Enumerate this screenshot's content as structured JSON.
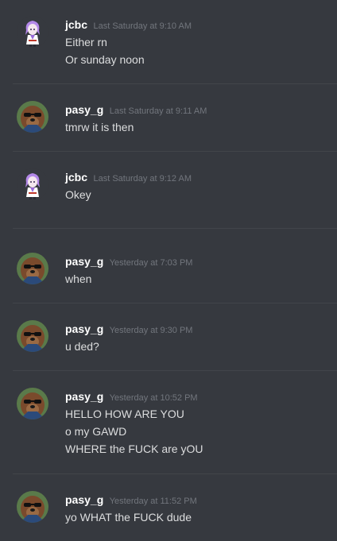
{
  "messages": [
    {
      "author": "jcbc",
      "timestamp": "Last Saturday at 9:10 AM",
      "avatar": "anime-avatar-icon",
      "lines": [
        "Either rn",
        "Or sunday noon"
      ]
    },
    {
      "author": "pasy_g",
      "timestamp": "Last Saturday at 9:11 AM",
      "avatar": "dog-sunglasses-avatar-icon",
      "lines": [
        "tmrw it is then"
      ]
    },
    {
      "author": "jcbc",
      "timestamp": "Last Saturday at 9:12 AM",
      "avatar": "anime-avatar-icon",
      "lines": [
        "Okey"
      ]
    },
    {
      "author": "pasy_g",
      "timestamp": "Yesterday at 7:03 PM",
      "avatar": "dog-sunglasses-avatar-icon",
      "lines": [
        "when"
      ]
    },
    {
      "author": "pasy_g",
      "timestamp": "Yesterday at 9:30 PM",
      "avatar": "dog-sunglasses-avatar-icon",
      "lines": [
        "u ded?"
      ]
    },
    {
      "author": "pasy_g",
      "timestamp": "Yesterday at 10:52 PM",
      "avatar": "dog-sunglasses-avatar-icon",
      "lines": [
        "HELLO HOW ARE YOU",
        "o my GAWD",
        "WHERE the FUCK are yOU"
      ]
    },
    {
      "author": "pasy_g",
      "timestamp": "Yesterday at 11:52 PM",
      "avatar": "dog-sunglasses-avatar-icon",
      "lines": [
        "yo WHAT the FUCK dude"
      ]
    }
  ],
  "colors": {
    "background": "#36393f",
    "username": "#ffffff",
    "timestamp": "#72767d",
    "text": "#dcddde",
    "divider": "#42454a"
  }
}
